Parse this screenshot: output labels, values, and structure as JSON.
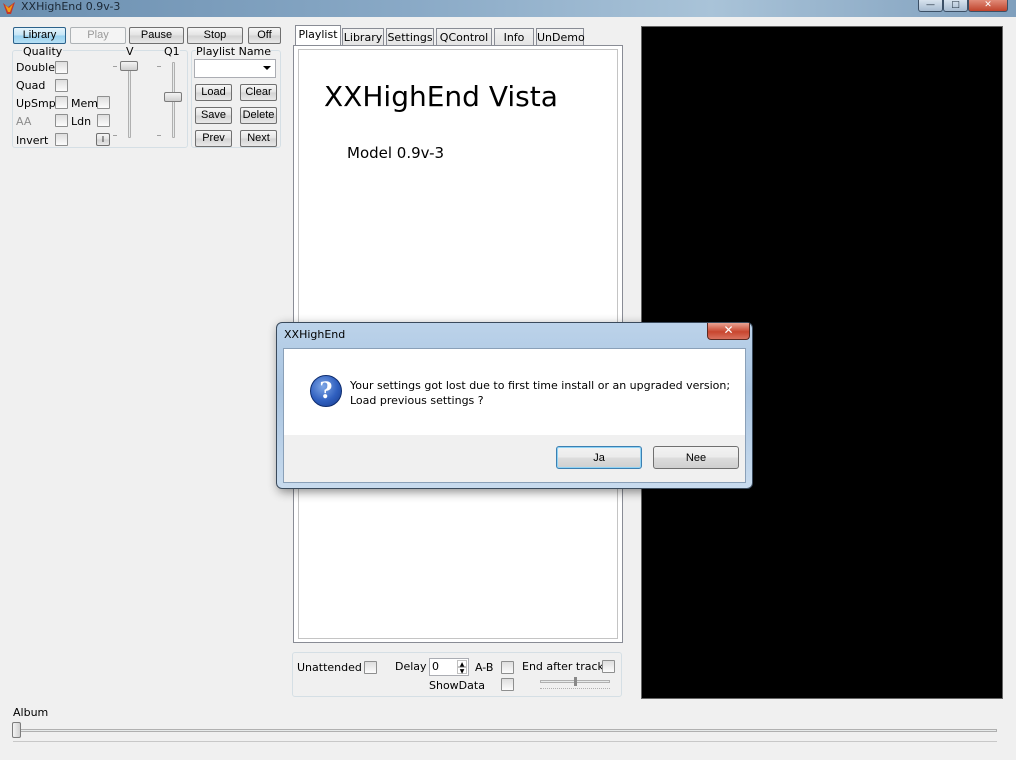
{
  "window": {
    "title": "XXHighEnd 0.9v-3",
    "minimize_glyph": "—",
    "maximize_glyph": "□",
    "close_glyph": "✕"
  },
  "toolbar": {
    "library": "Library",
    "play": "Play",
    "pause": "Pause",
    "stop": "Stop",
    "off": "Off"
  },
  "quality": {
    "group_label": "Quality",
    "v_label": "V",
    "q1_label": "Q1",
    "double": "Double",
    "quad": "Quad",
    "upsmp": "UpSmp",
    "mem": "Mem",
    "aa": "AA",
    "ldn": "Ldn",
    "invert": "Invert",
    "i_button": "I"
  },
  "playlist_panel": {
    "name_label": "Playlist Name",
    "name_value": "",
    "load": "Load",
    "clear": "Clear",
    "save": "Save",
    "delete": "Delete",
    "prev": "Prev",
    "next": "Next"
  },
  "tabs": [
    {
      "label": "Playlist"
    },
    {
      "label": "Library"
    },
    {
      "label": "Settings"
    },
    {
      "label": "QControl"
    },
    {
      "label": "Info"
    },
    {
      "label": "UnDemo"
    }
  ],
  "main": {
    "heading": "XXHighEnd Vista",
    "model": "Model 0.9v-3"
  },
  "bottom_controls": {
    "unattended": "Unattended",
    "delay": "Delay",
    "delay_value": "0",
    "ab": "A-B",
    "end_after_track": "End after track",
    "showdata": "ShowData",
    "album": "Album"
  },
  "dialog": {
    "title": "XXHighEnd",
    "close_glyph": "✕",
    "icon_glyph": "?",
    "message_line1": "Your settings got lost due to first time install or an upgraded version;",
    "message_line2": "Load previous settings ?",
    "yes": "Ja",
    "no": "Nee"
  },
  "icons": {
    "app": "speaker-icon",
    "question": "question-icon",
    "dropdown": "chevron-down-icon"
  }
}
